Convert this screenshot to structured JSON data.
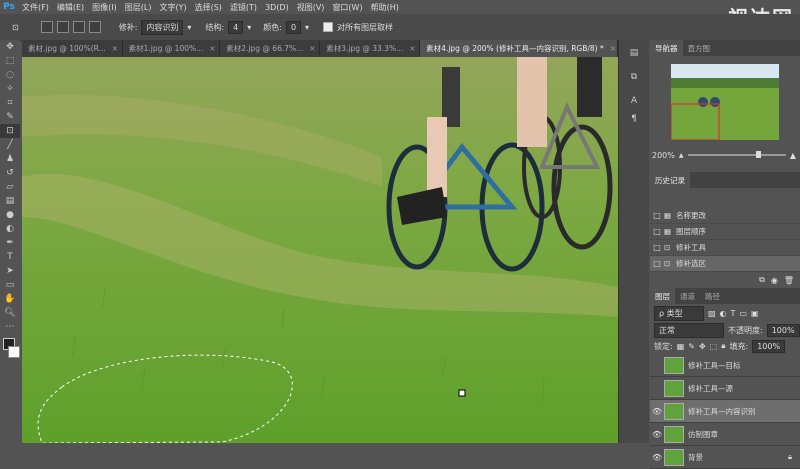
{
  "app": {
    "logo": "Ps",
    "watermark": "视达网"
  },
  "menu": [
    "文件(F)",
    "编辑(E)",
    "图像(I)",
    "图层(L)",
    "文字(Y)",
    "选择(S)",
    "滤镜(T)",
    "3D(D)",
    "视图(V)",
    "窗口(W)",
    "帮助(H)"
  ],
  "options": {
    "patch_label": "修补:",
    "patch_value": "内容识别",
    "structure_label": "结构:",
    "structure_value": "4",
    "color_label": "颜色:",
    "color_value": "0",
    "sample_all_label": "对所有图层取样"
  },
  "tabs": [
    {
      "label": "素材.jpg @ 100%(R..."
    },
    {
      "label": "素材1.jpg @ 100%..."
    },
    {
      "label": "素材2.jpg @ 66.7%..."
    },
    {
      "label": "素材3.jpg @ 33.3%..."
    },
    {
      "label": "素材4.jpg @ 200% (修补工具—内容识别, RGB/8) *"
    }
  ],
  "navigator": {
    "tab": "导航器",
    "tab2": "直方图",
    "zoom": "200%"
  },
  "history": {
    "tab": "历史记录",
    "items": [
      "名称更改",
      "图层顺序",
      "修补工具",
      "修补选区"
    ]
  },
  "layers": {
    "tabs": [
      "图层",
      "通道",
      "路径"
    ],
    "kind_label": "类型",
    "blend_mode": "正常",
    "opacity_label": "不透明度:",
    "opacity_value": "100%",
    "lock_label": "锁定:",
    "fill_label": "填充:",
    "fill_value": "100%",
    "items": [
      "修补工具—目标",
      "修补工具—源",
      "修补工具—内容识别",
      "仿制图章",
      "背景"
    ]
  },
  "colors": {
    "accent": "#31a8ff",
    "panel": "#535353",
    "dark": "#3c3c3c",
    "grass": "#6aa532"
  }
}
